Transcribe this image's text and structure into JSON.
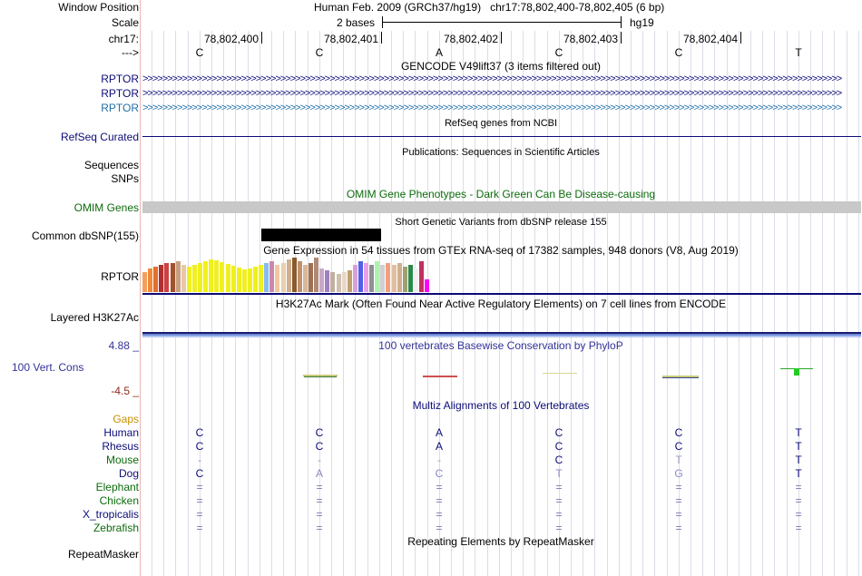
{
  "header": {
    "window_position_label": "Window Position",
    "window_position_text": "Human Feb. 2009 (GRCh37/hg19)   chr17:78,802,400-78,802,405 (6 bp)",
    "scale_label": "Scale",
    "scale_text": "2 bases",
    "assembly": "hg19",
    "chrom_label": "chr17:",
    "strand_label": "--->",
    "positions": [
      "78,802,400",
      "78,802,401",
      "78,802,402",
      "78,802,403",
      "78,802,404"
    ],
    "bases": [
      "C",
      "C",
      "A",
      "C",
      "C",
      "T"
    ]
  },
  "tracks": {
    "gencode": {
      "title": "GENCODE V49lift37 (3 items filtered out)",
      "rows": [
        "RPTOR",
        "RPTOR",
        "RPTOR"
      ],
      "arrows": ">>>>>>>>>>>>>>>>>>>>>>>>>>>>>>>>>>>>>>>>>>>>>>>>>>>>>>>>>>>>>>>>>>>>>>>>>>>>>>>>>>>>>>>>>>>>>>>>>>>>>>>>>>>>>>>>>>>>>>>>>>>>>>>>>>>>>>>>>>>>>>",
      "colors": [
        "#0c0c78",
        "#0c0c78",
        "#1f6fa8"
      ]
    },
    "refseq": {
      "title": "RefSeq genes from NCBI",
      "label": "RefSeq Curated",
      "color": "#0c0c78"
    },
    "publications": {
      "title": "Publications: Sequences in Scientific Articles",
      "labels": [
        "Sequences",
        "SNPs"
      ]
    },
    "omim": {
      "title": "OMIM Gene Phenotypes - Dark Green Can Be Disease-causing",
      "label": "OMIM Genes",
      "color": "#0d6b0d",
      "bar_color": "#c8c8c8"
    },
    "dbsnp": {
      "title": "Short Genetic Variants from dbSNP release 155",
      "label": "Common dbSNP(155)"
    },
    "gtex": {
      "title": "Gene Expression in 54 tissues from GTEx RNA-seq of 17382 samples, 948 donors (V8, Aug 2019)",
      "label": "RPTOR"
    },
    "h3k27ac": {
      "title": "H3K27Ac Mark (Often Found Near Active Regulatory Elements) on 7 cell lines from ENCODE",
      "label": "Layered H3K27Ac"
    },
    "phylop": {
      "title": "100 vertebrates Basewise Conservation by PhyloP",
      "label": "100 Vert. Cons",
      "max": "4.88 _",
      "min": "-4.5 _",
      "color": "#333399",
      "min_color": "#8b2a1a"
    },
    "multiz": {
      "title": "Multiz Alignments of 100 Vertebrates",
      "gaps_label": "Gaps",
      "species": [
        {
          "name": "Human",
          "color": "#0c0c78",
          "bases": [
            "C",
            "C",
            "A",
            "C",
            "C",
            "T"
          ],
          "base_color": "#0c0c78"
        },
        {
          "name": "Rhesus",
          "color": "#0c0c78",
          "bases": [
            "C",
            "C",
            "A",
            "C",
            "C",
            "T"
          ],
          "base_color": "#0c0c78"
        },
        {
          "name": "Mouse",
          "color": "#0d6b0d",
          "bases": [
            "-",
            "-",
            "-",
            "C",
            "T",
            "T"
          ],
          "base_color": "#0c0c78"
        },
        {
          "name": "Dog",
          "color": "#0c0c78",
          "bases": [
            "C",
            "A",
            "C",
            "T",
            "G",
            "T"
          ],
          "base_color": "#0c0c78"
        },
        {
          "name": "Elephant",
          "color": "#0d6b0d",
          "bases": [
            "=",
            "=",
            "=",
            "=",
            "=",
            "="
          ],
          "base_color": "#7878b0"
        },
        {
          "name": "Chicken",
          "color": "#0d6b0d",
          "bases": [
            "=",
            "=",
            "=",
            "=",
            "=",
            "="
          ],
          "base_color": "#7878b0"
        },
        {
          "name": "X_tropicalis",
          "color": "#0c0c78",
          "bases": [
            "=",
            "=",
            "=",
            "=",
            "=",
            "="
          ],
          "base_color": "#7878b0"
        },
        {
          "name": "Zebrafish",
          "color": "#0d6b0d",
          "bases": [
            "=",
            "=",
            "=",
            "=",
            "=",
            "="
          ],
          "base_color": "#7878b0"
        }
      ]
    },
    "repeatmasker": {
      "title": "Repeating Elements by RepeatMasker",
      "label": "RepeatMasker"
    }
  },
  "colors": {
    "gaps": "#c89000",
    "track_blue": "#0c0c78",
    "track_green": "#0d6b0d"
  }
}
